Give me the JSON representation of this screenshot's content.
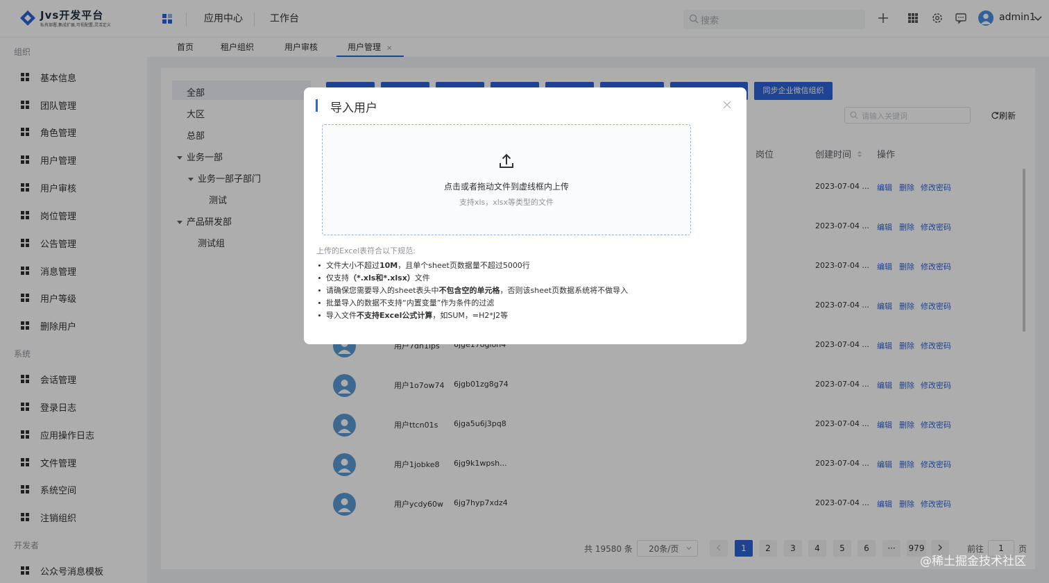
{
  "header": {
    "logo_title": "Jvs开发平台",
    "logo_subtitle": "私有部署,集成扩展,可视配置,灵活定义",
    "nav": [
      "应用中心",
      "工作台"
    ],
    "search_placeholder": "搜索",
    "username": "admin1"
  },
  "sidebar": {
    "groups": [
      {
        "title": "组织",
        "items": [
          "基本信息",
          "团队管理",
          "角色管理",
          "用户管理",
          "用户审核",
          "岗位管理",
          "公告管理",
          "消息管理",
          "用户等级",
          "删除用户"
        ]
      },
      {
        "title": "系统",
        "items": [
          "会话管理",
          "登录日志",
          "应用操作日志",
          "文件管理",
          "系统空间",
          "注销组织"
        ]
      },
      {
        "title": "开发者",
        "items": [
          "公众号消息模板"
        ]
      }
    ]
  },
  "tabs": [
    {
      "label": "首页"
    },
    {
      "label": "租户组织"
    },
    {
      "label": "用户审核"
    },
    {
      "label": "用户管理",
      "active": true,
      "close": "×"
    }
  ],
  "tree": {
    "items": [
      "全部",
      "大区",
      "总部",
      "业务一部",
      "业务一部子部门",
      "测试",
      "产品研发部",
      "测试组"
    ]
  },
  "toolbar": {
    "sync_wechat": "同步企业微信组织",
    "keyword_placeholder": "请输入关键词",
    "refresh": "刷新"
  },
  "table": {
    "headers": {
      "post": "岗位",
      "created": "创建时间",
      "ops": "操作"
    },
    "ops": {
      "edit": "编辑",
      "delete": "删除",
      "password": "修改密码"
    },
    "rows": [
      {
        "name": "",
        "account": "",
        "created": "2023-07-04 ..."
      },
      {
        "name": "",
        "account": "",
        "created": "2023-07-04 ..."
      },
      {
        "name": "",
        "account": "",
        "created": "2023-07-04 ..."
      },
      {
        "name": "",
        "account": "",
        "created": "2023-07-04 ..."
      },
      {
        "name": "用户7dn1ips",
        "account": "6jge17ogion4",
        "created": "2023-07-04 ..."
      },
      {
        "name": "用户1o7ow74",
        "account": "6jgb01zg8g74",
        "created": "2023-07-04 ..."
      },
      {
        "name": "用户ttcn01s",
        "account": "6jga5u6j3pq8",
        "created": "2023-07-04 ..."
      },
      {
        "name": "用户1jobke8",
        "account": "6jg9k1wpsh...",
        "created": "2023-07-04 ..."
      },
      {
        "name": "用户ycdy60w",
        "account": "6jg7hyp7xdz4",
        "created": "2023-07-04 ..."
      }
    ]
  },
  "pagination": {
    "total": "共 19580 条",
    "page_size": "20条/页",
    "pages": [
      "1",
      "2",
      "3",
      "4",
      "5",
      "6",
      "···",
      "979"
    ],
    "current": "1",
    "goto_prefix": "前往",
    "goto_value": "1",
    "goto_suffix": "页"
  },
  "modal": {
    "title": "导入用户",
    "drop_main": "点击或者拖动文件到虚线框内上传",
    "drop_sub": "支持xls，xlsx等类型的文件",
    "rules_title": "上传的Excel表符合以下规范:",
    "rules": [
      {
        "pre": "文件大小不超过",
        "bold": "10M",
        "post": "，且单个sheet页数据量不超过5000行"
      },
      {
        "pre": "仅支持",
        "bold": "（*.xls和*.xlsx）",
        "post": "文件"
      },
      {
        "pre": "请确保您需要导入的sheet表头中",
        "bold": "不包含空的单元格",
        "post": "，否则该sheet页数据系统将不做导入"
      },
      {
        "pre": "批量导入的数据不支持“内置变量”作为条件的过滤",
        "bold": "",
        "post": ""
      },
      {
        "pre": "导入文件",
        "bold": "不支持Excel公式计算",
        "post": "，如SUM，=H2*J2等"
      }
    ]
  },
  "watermark": "@稀土掘金技术社区"
}
